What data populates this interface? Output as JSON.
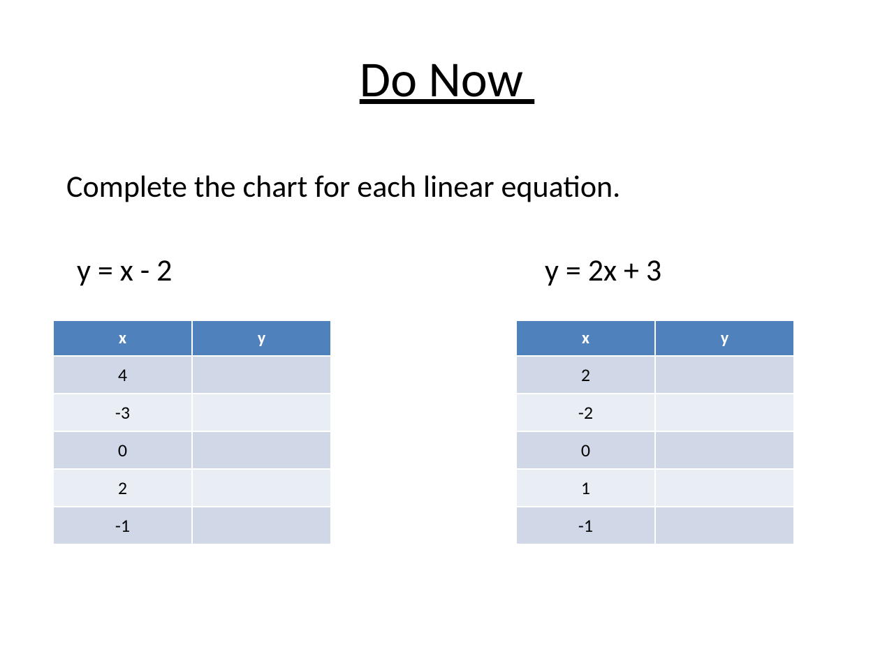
{
  "chart_data": [
    {
      "type": "table",
      "equation": "y = x - 2",
      "columns": [
        "x",
        "y"
      ],
      "rows": [
        {
          "x": "4",
          "y": ""
        },
        {
          "x": "-3",
          "y": ""
        },
        {
          "x": "0",
          "y": ""
        },
        {
          "x": "2",
          "y": ""
        },
        {
          "x": "-1",
          "y": ""
        }
      ]
    },
    {
      "type": "table",
      "equation": "y = 2x + 3",
      "columns": [
        "x",
        "y"
      ],
      "rows": [
        {
          "x": "2",
          "y": ""
        },
        {
          "x": "-2",
          "y": ""
        },
        {
          "x": "0",
          "y": ""
        },
        {
          "x": "1",
          "y": ""
        },
        {
          "x": "-1",
          "y": ""
        }
      ]
    }
  ],
  "title": "Do Now ",
  "instruction": "Complete the chart for each linear equation."
}
